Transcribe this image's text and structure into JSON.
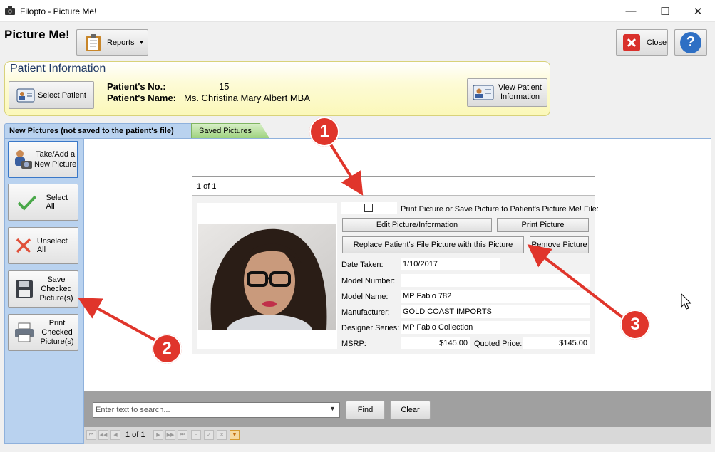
{
  "window": {
    "title": "Filopto - Picture Me!",
    "minimize": "—",
    "maximize": "☐",
    "close": "✕"
  },
  "toolbar": {
    "heading": "Picture Me!",
    "reports_label": "Reports",
    "close_label": "Close",
    "help_label": "?"
  },
  "patient": {
    "panel_title": "Patient Information",
    "select_label": "Select Patient",
    "number_label": "Patient's No.:",
    "number_value": "15",
    "name_label": "Patient's Name:",
    "name_value": "Ms. Christina Mary Albert MBA",
    "view_label_1": "View Patient",
    "view_label_2": "Information"
  },
  "tabs": {
    "new": "New Pictures (not saved to the patient's file)",
    "saved": "Saved Pictures"
  },
  "sidebar": {
    "take_1": "Take/Add a",
    "take_2": "New Picture",
    "select_all": "Select All",
    "unselect_all": "Unselect All",
    "save_1": "Save",
    "save_2": "Checked",
    "save_3": "Picture(s)",
    "print_1": "Print",
    "print_2": "Checked",
    "print_3": "Picture(s)"
  },
  "card": {
    "counter": "1 of 1",
    "print_save_label": "Print Picture or Save Picture to Patient's Picture Me! File:",
    "edit_label": "Edit Picture/Information",
    "print_label": "Print Picture",
    "replace_label": "Replace Patient's File Picture with this Picture",
    "remove_label": "Remove Picture",
    "fields": {
      "date_taken_label": "Date Taken:",
      "date_taken": "1/10/2017",
      "model_number_label": "Model Number:",
      "model_number": "",
      "model_name_label": "Model Name:",
      "model_name": "MP Fabio 782",
      "manufacturer_label": "Manufacturer:",
      "manufacturer": "GOLD COAST IMPORTS",
      "designer_series_label": "Designer Series:",
      "designer_series": "MP Fabio Collection",
      "msrp_label": "MSRP:",
      "msrp": "$145.00",
      "quoted_price_label": "Quoted Price:",
      "quoted_price": "$145.00"
    }
  },
  "search": {
    "placeholder": "Enter text to search...",
    "find_label": "Find",
    "clear_label": "Clear"
  },
  "nav": {
    "page": "1 of 1"
  },
  "callouts": {
    "one": "1",
    "two": "2",
    "three": "3"
  },
  "colors": {
    "callout": "#e0352b",
    "panel_yellow": "#fbf8b9",
    "rail_blue": "#b9d2ef",
    "saved_tab_green": "#9ed27e"
  }
}
